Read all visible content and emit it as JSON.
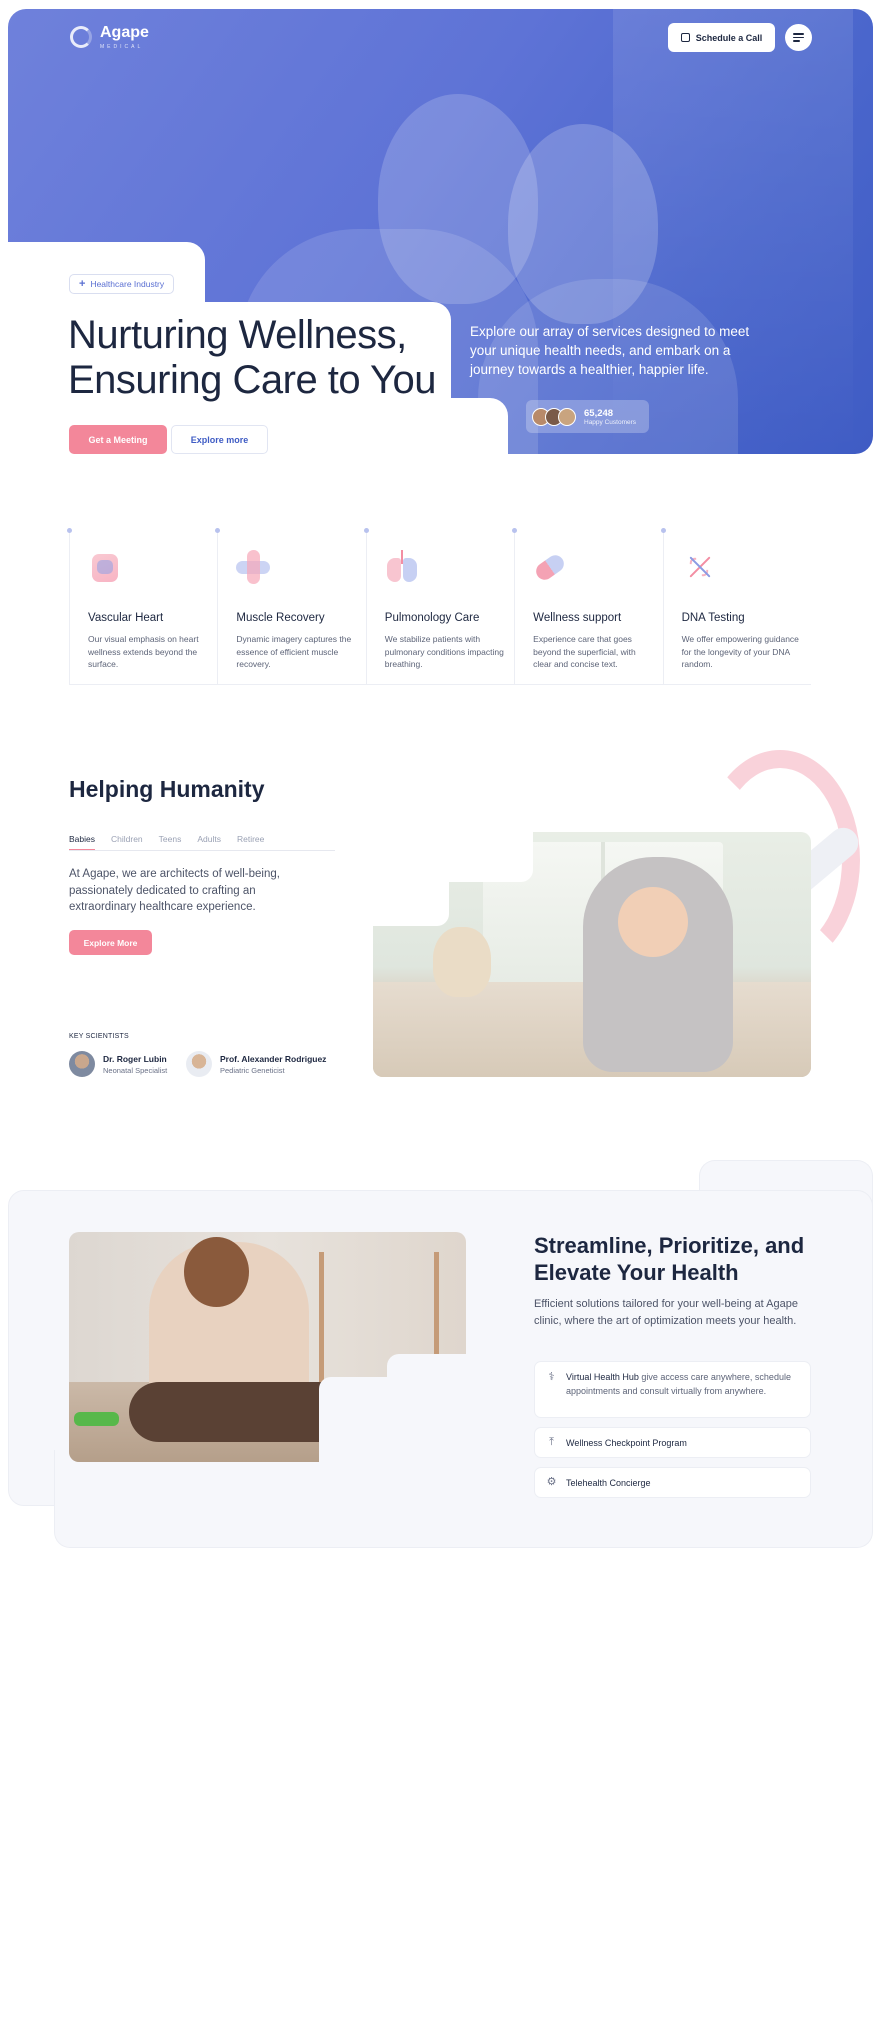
{
  "brand": {
    "name": "Agape",
    "sub": "MEDICAL"
  },
  "header": {
    "schedule_label": "Schedule a Call"
  },
  "hero": {
    "badge": "Healthcare Industry",
    "title": "Nurturing Wellness, Ensuring Care to You",
    "cta_primary": "Get a Meeting",
    "cta_secondary": "Explore more",
    "description": "Explore our array of services designed to meet your unique health needs, and embark on a journey towards a healthier, happier life.",
    "customers_count": "65,248",
    "customers_label": "Happy Customers"
  },
  "services": [
    {
      "icon": "heart-icon",
      "title": "Vascular Heart",
      "desc": "Our visual emphasis on heart wellness extends beyond the surface."
    },
    {
      "icon": "muscle-icon",
      "title": "Muscle Recovery",
      "desc": "Dynamic imagery captures the essence of efficient muscle recovery."
    },
    {
      "icon": "lungs-icon",
      "title": "Pulmonology Care",
      "desc": "We stabilize patients with pulmonary conditions impacting breathing."
    },
    {
      "icon": "pill-icon",
      "title": "Wellness support",
      "desc": "Experience care that goes beyond the superficial, with clear and concise text."
    },
    {
      "icon": "dna-icon",
      "title": "DNA Testing",
      "desc": "We offer empowering guidance for the longevity of your DNA random."
    }
  ],
  "humanity": {
    "title": "Helping Humanity",
    "tabs": [
      "Babies",
      "Children",
      "Teens",
      "Adults",
      "Retiree"
    ],
    "active_tab": "Babies",
    "description": "At Agape, we are architects of well-being, passionately dedicated to crafting an extraordinary healthcare experience.",
    "cta": "Explore More",
    "scientists_label": "KEY SCIENTISTS",
    "scientists": [
      {
        "name": "Dr. Roger Lubin",
        "role": "Neonatal Specialist"
      },
      {
        "name": "Prof. Alexander Rodriguez",
        "role": "Pediatric Geneticist"
      }
    ]
  },
  "streamline": {
    "title": "Streamline, Prioritize, and Elevate Your Health",
    "description": "Efficient solutions tailored for your well-being at Agape clinic, where the art of optimization meets your health.",
    "features": [
      {
        "icon": "stethoscope-icon",
        "strong": "Virtual Health Hub",
        "text": " give access care anywhere, schedule appointments and consult virtually from anywhere."
      },
      {
        "icon": "upload-icon",
        "label": "Wellness Checkpoint Program"
      },
      {
        "icon": "gear-icon",
        "label": "Telehealth Concierge"
      }
    ]
  },
  "colors": {
    "primary": "#5a6fd2",
    "accent": "#f3879a",
    "text": "#1d2740"
  }
}
